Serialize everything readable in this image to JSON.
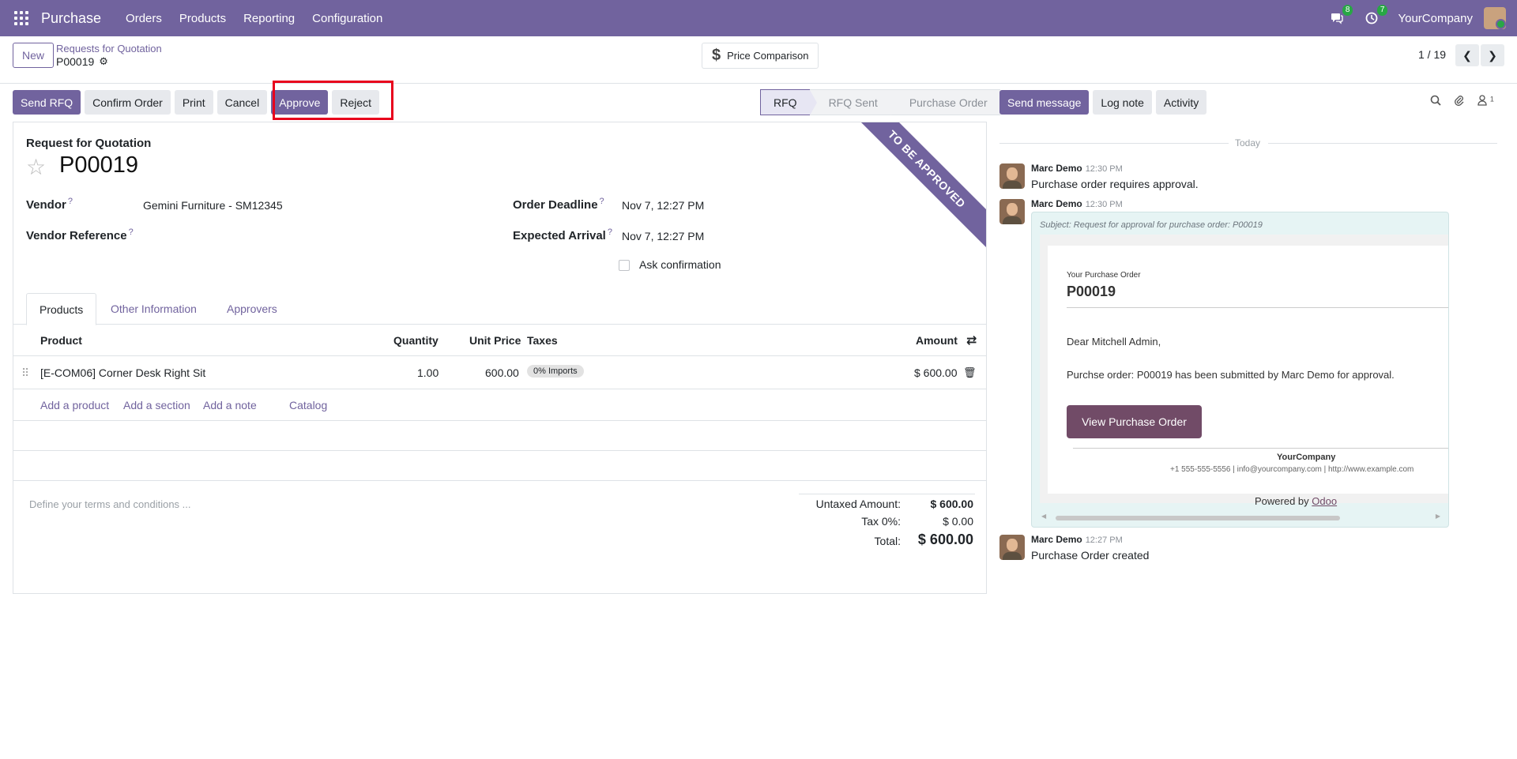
{
  "navbar": {
    "brand": "Purchase",
    "menus": [
      "Orders",
      "Products",
      "Reporting",
      "Configuration"
    ],
    "messages_badge": "8",
    "activities_badge": "7",
    "company": "YourCompany"
  },
  "control_panel": {
    "new_label": "New",
    "breadcrumb": "Requests for Quotation",
    "record": "P00019",
    "price_comparison": "Price Comparison",
    "pager": "1 / 19",
    "prev_icon": "chevron-left-icon",
    "next_icon": "chevron-right-icon"
  },
  "actions": [
    "Send RFQ",
    "Confirm Order",
    "Print",
    "Cancel",
    "Approve",
    "Reject"
  ],
  "stages": [
    "RFQ",
    "RFQ Sent",
    "Purchase Order"
  ],
  "active_stage": "RFQ",
  "form": {
    "ribbon": "TO BE APPROVED",
    "label": "Request for Quotation",
    "title": "P00019",
    "vendor_label": "Vendor",
    "vendor_value": "Gemini Furniture - SM12345",
    "vendor_ref_label": "Vendor Reference",
    "order_deadline_label": "Order Deadline",
    "order_deadline_value": "Nov 7, 12:27 PM",
    "expected_arrival_label": "Expected Arrival",
    "expected_arrival_value": "Nov 7, 12:27 PM",
    "ask_confirmation": "Ask confirmation",
    "help": "?",
    "tabs": [
      "Products",
      "Other Information",
      "Approvers"
    ],
    "columns": {
      "product": "Product",
      "quantity": "Quantity",
      "unit_price": "Unit Price",
      "taxes": "Taxes",
      "amount": "Amount"
    },
    "lines": [
      {
        "product": "[E-COM06] Corner Desk Right Sit",
        "quantity": "1.00",
        "unit_price": "600.00",
        "tax": "0% Imports",
        "amount": "$ 600.00"
      }
    ],
    "add_links": [
      "Add a product",
      "Add a section",
      "Add a note",
      "Catalog"
    ],
    "terms_placeholder": "Define your terms and conditions ...",
    "untaxed_label": "Untaxed Amount:",
    "untaxed_value": "$ 600.00",
    "tax_label": "Tax 0%:",
    "tax_value": "$ 0.00",
    "total_label": "Total:",
    "total_value": "$ 600.00"
  },
  "chatter": {
    "send_message": "Send message",
    "log_note": "Log note",
    "activity": "Activity",
    "followers_count": "1",
    "today": "Today",
    "messages": [
      {
        "author": "Marc Demo",
        "time": "12:30 PM",
        "body": "Purchase order requires approval."
      },
      {
        "author": "Marc Demo",
        "time": "12:30 PM",
        "body": ""
      },
      {
        "author": "Marc Demo",
        "time": "12:27 PM",
        "body": "Purchase Order created"
      }
    ],
    "mail": {
      "subject": "Subject: Request for approval for purchase order: P00019",
      "small": "Your Purchase Order",
      "title": "P00019",
      "greeting": "Dear Mitchell Admin,",
      "text": "Purchse order: P00019 has been submitted by Marc Demo for approval.",
      "button": "View Purchase Order",
      "company": "YourCompany",
      "contact": "+1 555-555-5556 | info@yourcompany.com | http://www.example.com",
      "powered_by": "Powered by",
      "powered_link": "Odoo"
    }
  },
  "colors": {
    "brand": "#71639e",
    "highlight": "#e8001c",
    "mail_button": "#714b67"
  }
}
